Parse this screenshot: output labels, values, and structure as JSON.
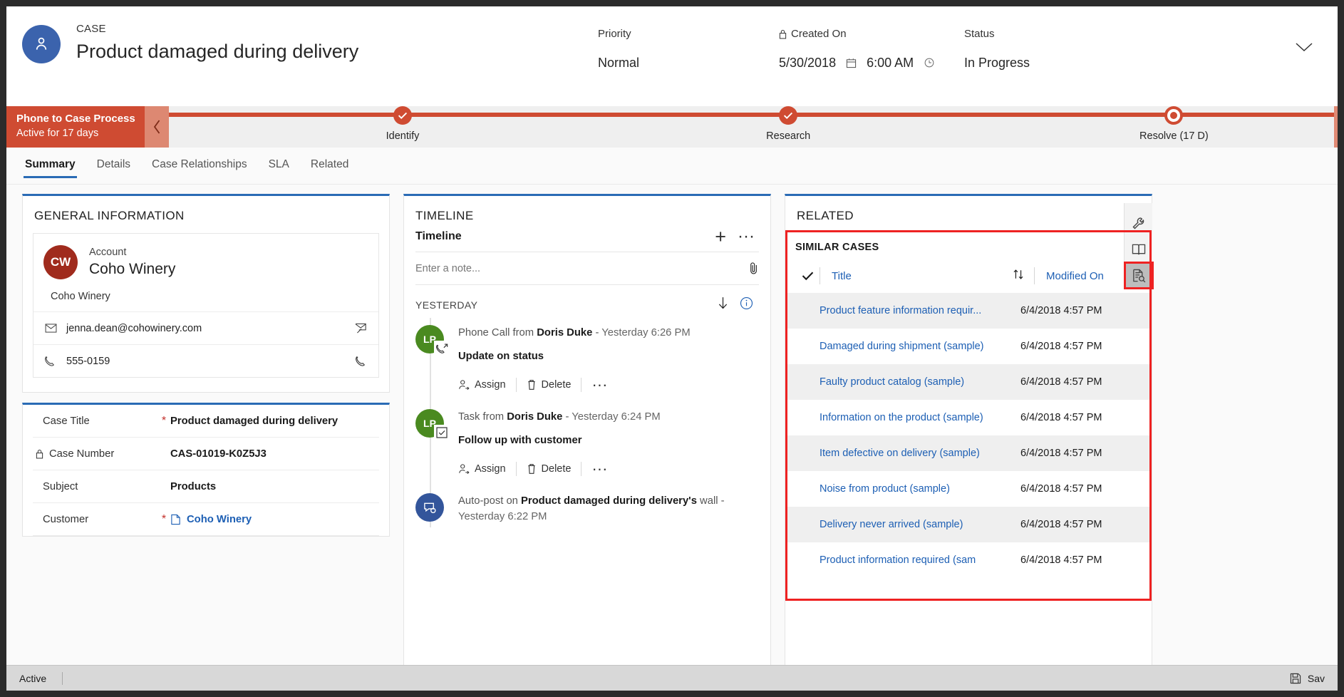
{
  "header": {
    "entity_label": "CASE",
    "record_title": "Product damaged during delivery",
    "fields": [
      {
        "label": "Priority",
        "value": "Normal",
        "locked": false
      },
      {
        "label": "Created On",
        "value": "5/30/2018",
        "value2": "6:00 AM",
        "locked": true
      },
      {
        "label": "Status",
        "value": "In Progress",
        "locked": false
      }
    ]
  },
  "process": {
    "name": "Phone to Case Process",
    "subtitle": "Active for 17 days",
    "stages": [
      {
        "label": "Identify",
        "state": "complete"
      },
      {
        "label": "Research",
        "state": "complete"
      },
      {
        "label": "Resolve  (17 D)",
        "state": "current"
      }
    ]
  },
  "tabs": [
    {
      "label": "Summary",
      "active": true
    },
    {
      "label": "Details",
      "active": false
    },
    {
      "label": "Case Relationships",
      "active": false
    },
    {
      "label": "SLA",
      "active": false
    },
    {
      "label": "Related",
      "active": false
    }
  ],
  "general_information": {
    "section_title": "GENERAL INFORMATION",
    "account": {
      "initials": "CW",
      "label": "Account",
      "name": "Coho Winery",
      "sub_name": "Coho Winery",
      "email": "jenna.dean@cohowinery.com",
      "phone": "555-0159"
    },
    "fields": [
      {
        "label": "Case Title",
        "required": true,
        "locked": false,
        "value": "Product damaged during delivery",
        "link": false
      },
      {
        "label": "Case Number",
        "required": false,
        "locked": true,
        "value": "CAS-01019-K0Z5J3",
        "link": false
      },
      {
        "label": "Subject",
        "required": false,
        "locked": false,
        "value": "Products",
        "link": false
      },
      {
        "label": "Customer",
        "required": true,
        "locked": false,
        "value": "Coho Winery",
        "link": true
      }
    ]
  },
  "timeline": {
    "section_title": "TIMELINE",
    "header_label": "Timeline",
    "note_placeholder": "Enter a note...",
    "day_group": "YESTERDAY",
    "items": [
      {
        "initials": "LP",
        "avatar_color": "green",
        "icon": "phone-outgoing-icon",
        "prefix": "Phone Call from ",
        "actor": "Doris Duke",
        "separator": " - ",
        "time": "Yesterday 6:26 PM",
        "subject": "Update on status",
        "actions": [
          "Assign",
          "Delete"
        ]
      },
      {
        "initials": "LP",
        "avatar_color": "green",
        "icon": "task-check-icon",
        "prefix": "Task from ",
        "actor": "Doris Duke",
        "separator": " - ",
        "time": "Yesterday 6:24 PM",
        "subject": "Follow up with customer",
        "actions": [
          "Assign",
          "Delete"
        ]
      },
      {
        "initials": "",
        "avatar_color": "blue",
        "icon": "auto-post-icon",
        "prefix": "Auto-post on ",
        "actor": "Product damaged during delivery's",
        "separator": " wall - ",
        "time": "Yesterday 6:22 PM",
        "subject": "",
        "actions": []
      }
    ]
  },
  "related": {
    "section_title": "RELATED",
    "similar_cases": {
      "title": "SIMILAR CASES",
      "columns": [
        "Title",
        "Modified On"
      ],
      "rows": [
        {
          "title": "Product feature information requir...",
          "modified_on": "6/4/2018 4:57 PM"
        },
        {
          "title": "Damaged during shipment (sample)",
          "modified_on": "6/4/2018 4:57 PM"
        },
        {
          "title": "Faulty product catalog (sample)",
          "modified_on": "6/4/2018 4:57 PM"
        },
        {
          "title": "Information on the product (sample)",
          "modified_on": "6/4/2018 4:57 PM"
        },
        {
          "title": "Item defective on delivery (sample)",
          "modified_on": "6/4/2018 4:57 PM"
        },
        {
          "title": "Noise from product (sample)",
          "modified_on": "6/4/2018 4:57 PM"
        },
        {
          "title": "Delivery never arrived (sample)",
          "modified_on": "6/4/2018 4:57 PM"
        },
        {
          "title": "Product information required (sam",
          "modified_on": "6/4/2018 4:57 PM"
        }
      ]
    }
  },
  "rail": [
    {
      "icon": "wrench-icon",
      "active": false
    },
    {
      "icon": "book-icon",
      "active": false
    },
    {
      "icon": "document-search-icon",
      "active": true
    }
  ],
  "footer": {
    "status": "Active",
    "save_label": "Sav"
  },
  "colors": {
    "process_red": "#cf4b32",
    "accent_blue": "#2a6bb5",
    "link_blue": "#1d5fb4",
    "account_avatar": "#a02b1d",
    "timeline_green": "#4a8a20",
    "timeline_blue": "#33559b",
    "highlight_red": "#ee2222"
  }
}
